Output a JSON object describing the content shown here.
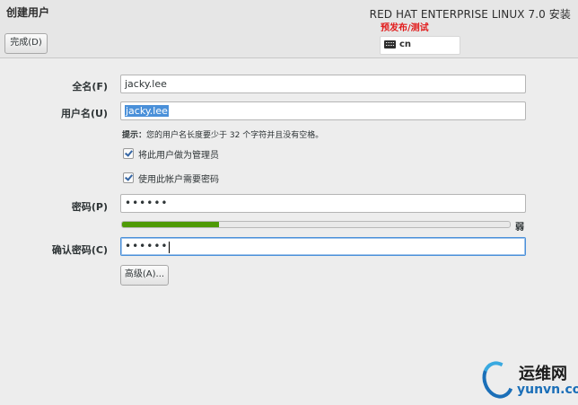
{
  "header": {
    "title": "创建用户",
    "done_label": "完成(D)",
    "product": "RED HAT ENTERPRISE LINUX 7.0 安装",
    "prerelease": "预发布/测试",
    "keyboard_layout": "cn",
    "keyboard_icon": "keyboard-icon"
  },
  "form": {
    "fullname_label": "全名(F)",
    "fullname_value": "jacky.lee",
    "username_label": "用户名(U)",
    "username_value": "jacky.lee",
    "hint_bold": "提示：",
    "hint_text": "您的用户名长度要少于 32 个字符并且没有空格。",
    "admin_check_label": "将此用户做为管理员",
    "admin_checked": true,
    "require_password_label": "使用此帐户需要密码",
    "require_password_checked": true,
    "password_label": "密码(P)",
    "password_value": "••••••",
    "strength_fraction": 0.25,
    "strength_color": "#4e9a06",
    "strength_label": "弱",
    "confirm_label": "确认密码(C)",
    "confirm_value": "••••••",
    "advanced_label": "高级(A)..."
  },
  "watermark": {
    "title": "运维网",
    "url": "yunvn.com"
  }
}
